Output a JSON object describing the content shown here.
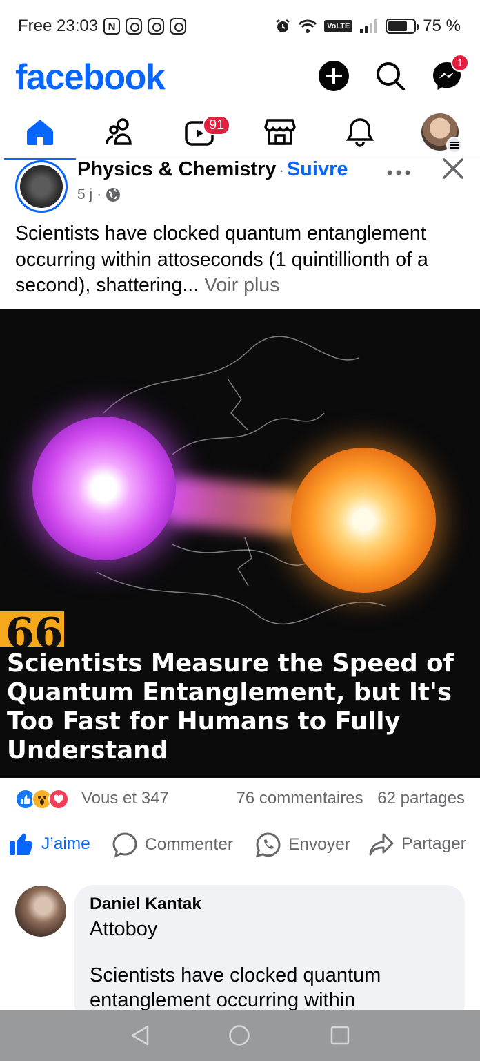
{
  "status_bar": {
    "carrier_time": "Free 23:03",
    "battery": "75 %",
    "network_badge": "VoLTE",
    "battery_level": 0.75
  },
  "header": {
    "logo": "facebook",
    "messenger_badge": "1"
  },
  "tabs": {
    "items": [
      {
        "name": "home",
        "icon": "home-icon",
        "active": true
      },
      {
        "name": "friends",
        "icon": "friends-icon"
      },
      {
        "name": "video",
        "icon": "video-icon",
        "badge": "91"
      },
      {
        "name": "marketplace",
        "icon": "marketplace-icon"
      },
      {
        "name": "notifications",
        "icon": "bell-icon"
      },
      {
        "name": "menu",
        "icon": "profile-avatar"
      }
    ],
    "video_badge": "91"
  },
  "post": {
    "page_name": "Physics & Chemistry",
    "separator": "·",
    "follow": "Suivre",
    "time": "5 j",
    "meta_sep": "·",
    "text": "Scientists have clocked quantum entanglement occurring within attoseconds (1 quintillionth of a second), shattering...",
    "see_more": "Voir plus",
    "image_quote_mark": "66",
    "image_headline": "Scientists Measure the Speed of Quantum Entanglement, but It's Too Fast for Humans to Fully Understand",
    "reactions_text": "Vous et 347",
    "comments_count": "76 commentaires",
    "shares_count": "62 partages"
  },
  "actions": {
    "like": "J’aime",
    "comment": "Commenter",
    "send": "Envoyer",
    "share": "Partager"
  },
  "comment": {
    "author": "Daniel Kantak",
    "line1": "Attoboy",
    "line2": "Scientists have clocked quantum entanglement occurring within"
  },
  "colors": {
    "brand_blue": "#0866ff",
    "badge_red": "#e41e3f",
    "secondary_text": "#65676b",
    "quote_box": "#f5a81c"
  }
}
